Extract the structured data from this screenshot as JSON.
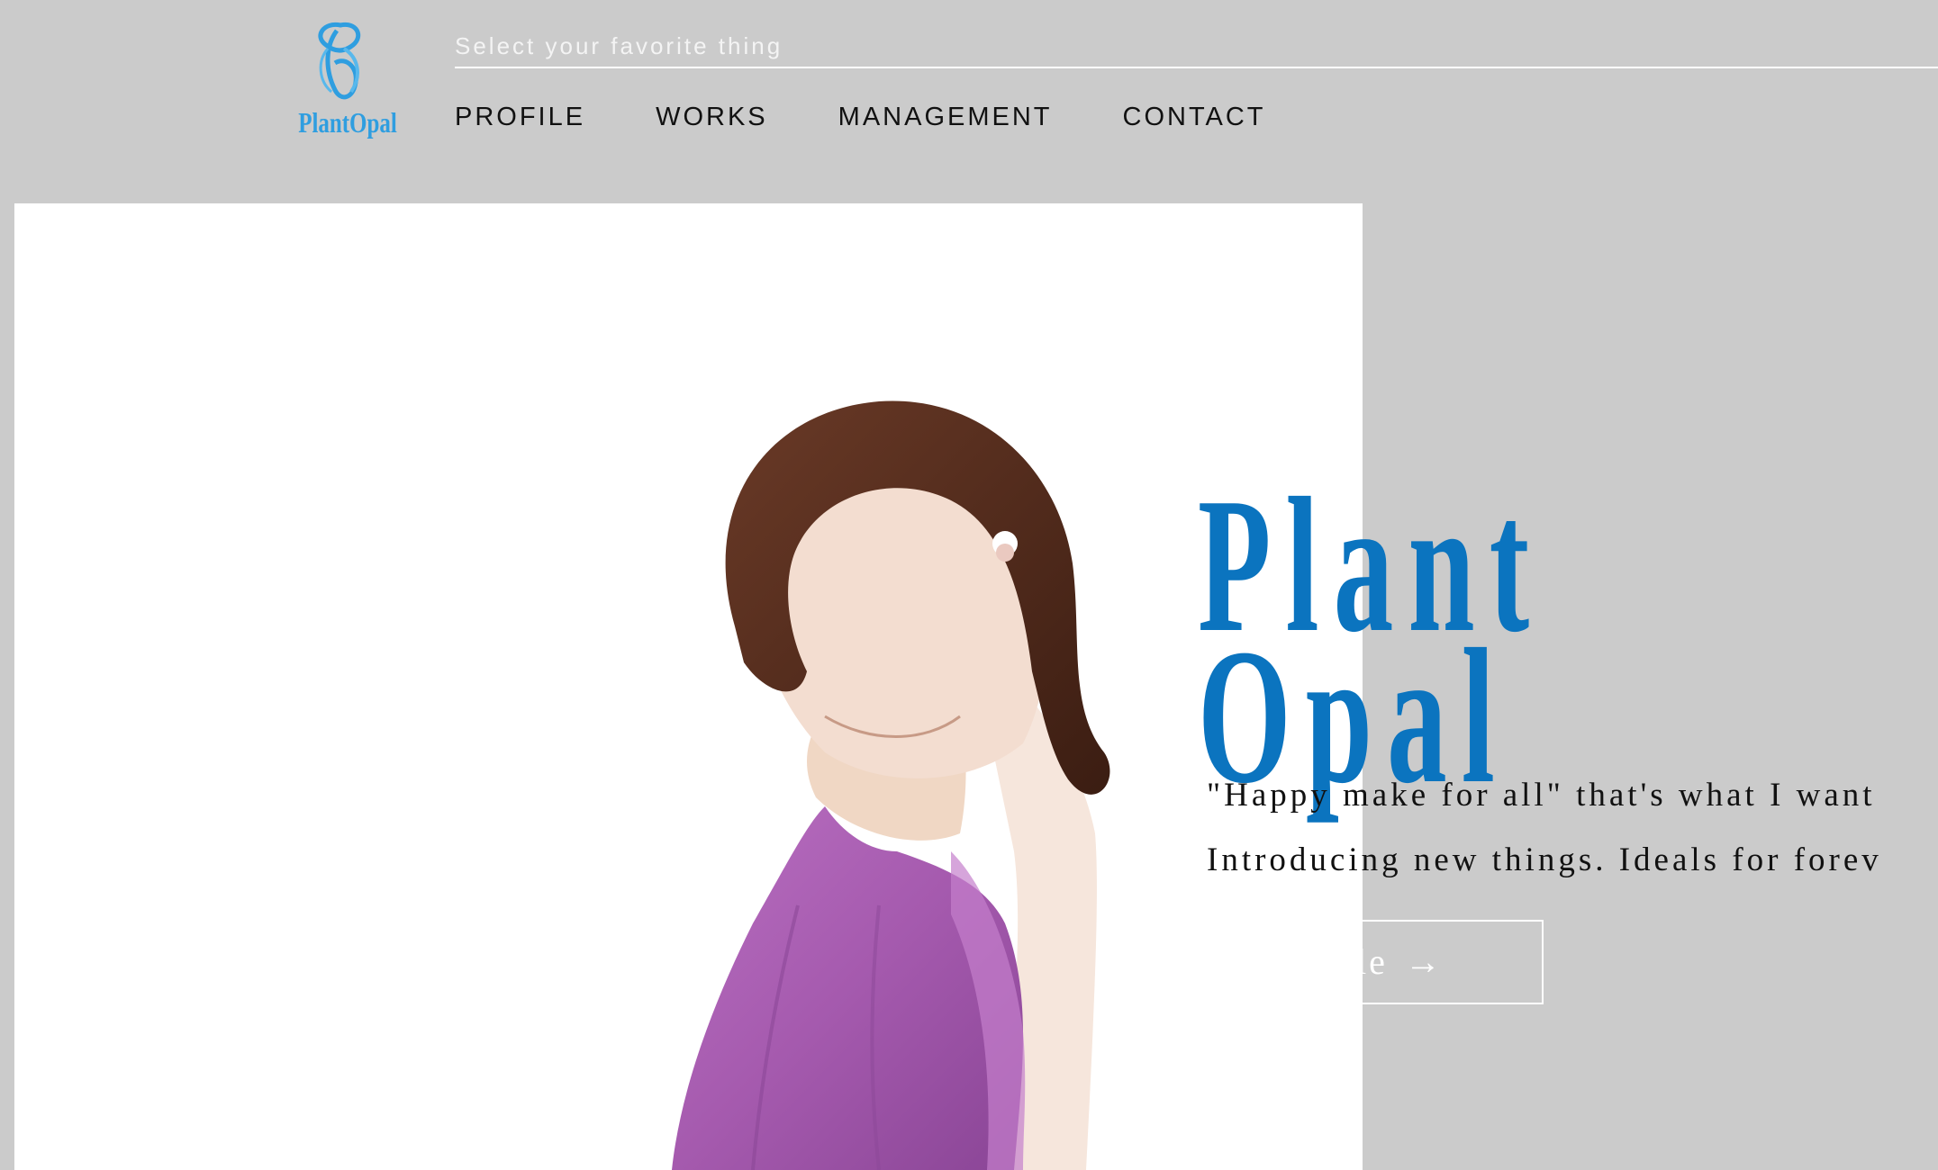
{
  "header": {
    "logo": {
      "text": "PlantOpal",
      "icon": "butterfly-icon",
      "color": "#2f9ee0"
    },
    "search": {
      "placeholder": "Select your favorite thing"
    },
    "nav": [
      {
        "label": "PROFILE"
      },
      {
        "label": "WORKS"
      },
      {
        "label": "MANAGEMENT"
      },
      {
        "label": "CONTACT"
      }
    ]
  },
  "hero": {
    "title_line1": "Plant",
    "title_line2": "Opal",
    "title_color": "#0b74bf",
    "tagline_line1": "\"Happy make for all\" that's what I want",
    "tagline_line2": "Introducing new things. Ideals for forev",
    "button": {
      "label": "Profile",
      "arrow": "→"
    }
  }
}
